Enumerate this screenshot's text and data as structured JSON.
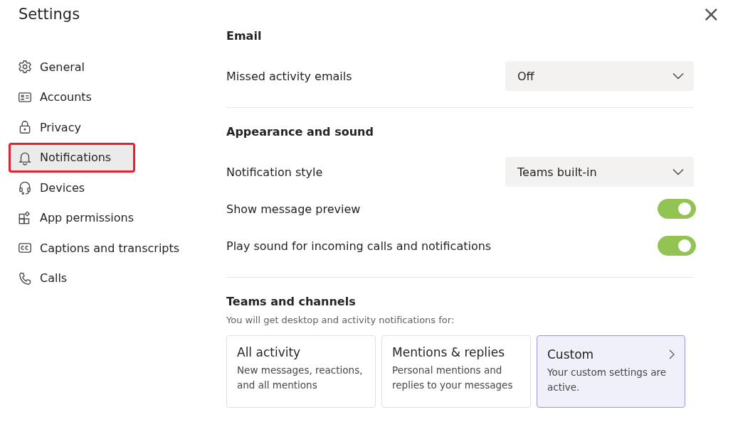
{
  "window": {
    "title": "Settings",
    "close": "×"
  },
  "sidebar": {
    "items": [
      {
        "label": "General",
        "kind": "gear",
        "selected": false,
        "highlighted": false
      },
      {
        "label": "Accounts",
        "kind": "card",
        "selected": false,
        "highlighted": false
      },
      {
        "label": "Privacy",
        "kind": "lock",
        "selected": false,
        "highlighted": false
      },
      {
        "label": "Notifications",
        "kind": "bell",
        "selected": true,
        "highlighted": true
      },
      {
        "label": "Devices",
        "kind": "headset",
        "selected": false,
        "highlighted": false
      },
      {
        "label": "App permissions",
        "kind": "apps",
        "selected": false,
        "highlighted": false
      },
      {
        "label": "Captions and transcripts",
        "kind": "cc",
        "selected": false,
        "highlighted": false
      },
      {
        "label": "Calls",
        "kind": "phone",
        "selected": false,
        "highlighted": false
      }
    ]
  },
  "sections": [
    {
      "title": "Email",
      "rows": [
        {
          "kind": "dropdown",
          "label": "Missed activity emails",
          "value": "Off"
        }
      ]
    },
    {
      "title": "Appearance and sound",
      "rows": [
        {
          "kind": "dropdown",
          "label": "Notification style",
          "value": "Teams built-in"
        },
        {
          "kind": "toggle",
          "label": "Show message preview",
          "on": true
        },
        {
          "kind": "toggle",
          "label": "Play sound for incoming calls and notifications",
          "on": true
        }
      ]
    },
    {
      "title": "Teams and channels",
      "subtitle": "You will get desktop and activity notifications for:",
      "options": [
        {
          "title": "All activity",
          "description": "New messages, reactions, and all mentions",
          "selected": false,
          "chevron": false
        },
        {
          "title": "Mentions & replies",
          "description": "Personal mentions and replies to your messages",
          "selected": false,
          "chevron": false
        },
        {
          "title": "Custom",
          "description": "Your custom settings are active.",
          "selected": true,
          "chevron": true
        }
      ]
    }
  ]
}
